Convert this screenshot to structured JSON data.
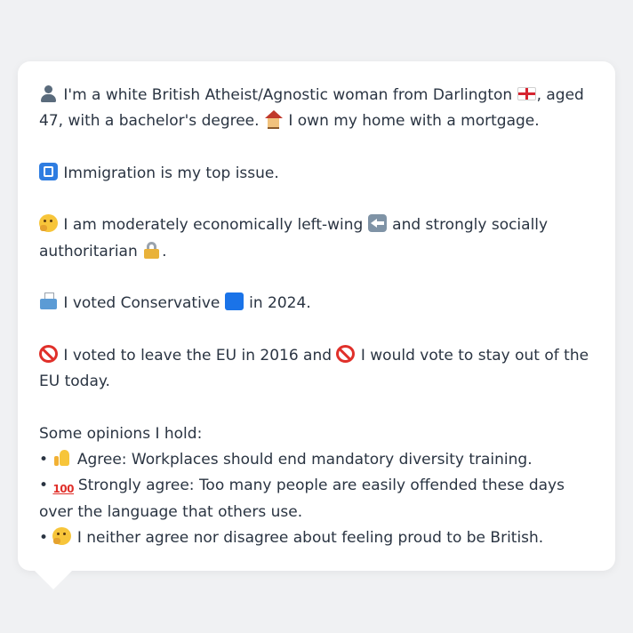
{
  "profile": {
    "intro_part1": " I'm a white British Atheist/Agnostic woman from Darlington ",
    "intro_part2": ", aged 47, with a bachelor's degree. ",
    "intro_part3": " I own my home with a mortgage.",
    "top_issue": " Immigration is my top issue.",
    "ideology_part1": " I am moderately economically left-wing ",
    "ideology_part2": " and strongly socially authoritarian ",
    "ideology_part3": ".",
    "vote_part1": " I voted Conservative ",
    "vote_part2": " in 2024.",
    "eu_part1": " I voted to leave the EU in 2016 and ",
    "eu_part2": " I would vote to stay out of the EU today.",
    "opinions_heading": "Some opinions I hold:",
    "opinions": [
      {
        "bullet": "•",
        "icon": "thumbs-up-icon",
        "text": " Agree: Workplaces should end mandatory diversity training."
      },
      {
        "bullet": "•",
        "icon": "hundred-points-icon",
        "text": " Strongly agree: Too many people are easily offended these days over the language that others use."
      },
      {
        "bullet": "•",
        "icon": "thinking-face-icon",
        "text": " I neither agree nor disagree about feeling proud to be British."
      }
    ]
  },
  "icons": {
    "hundred_label": "100"
  },
  "colors": {
    "background": "#f0f1f3",
    "bubble": "#ffffff",
    "text": "#2a3442"
  }
}
